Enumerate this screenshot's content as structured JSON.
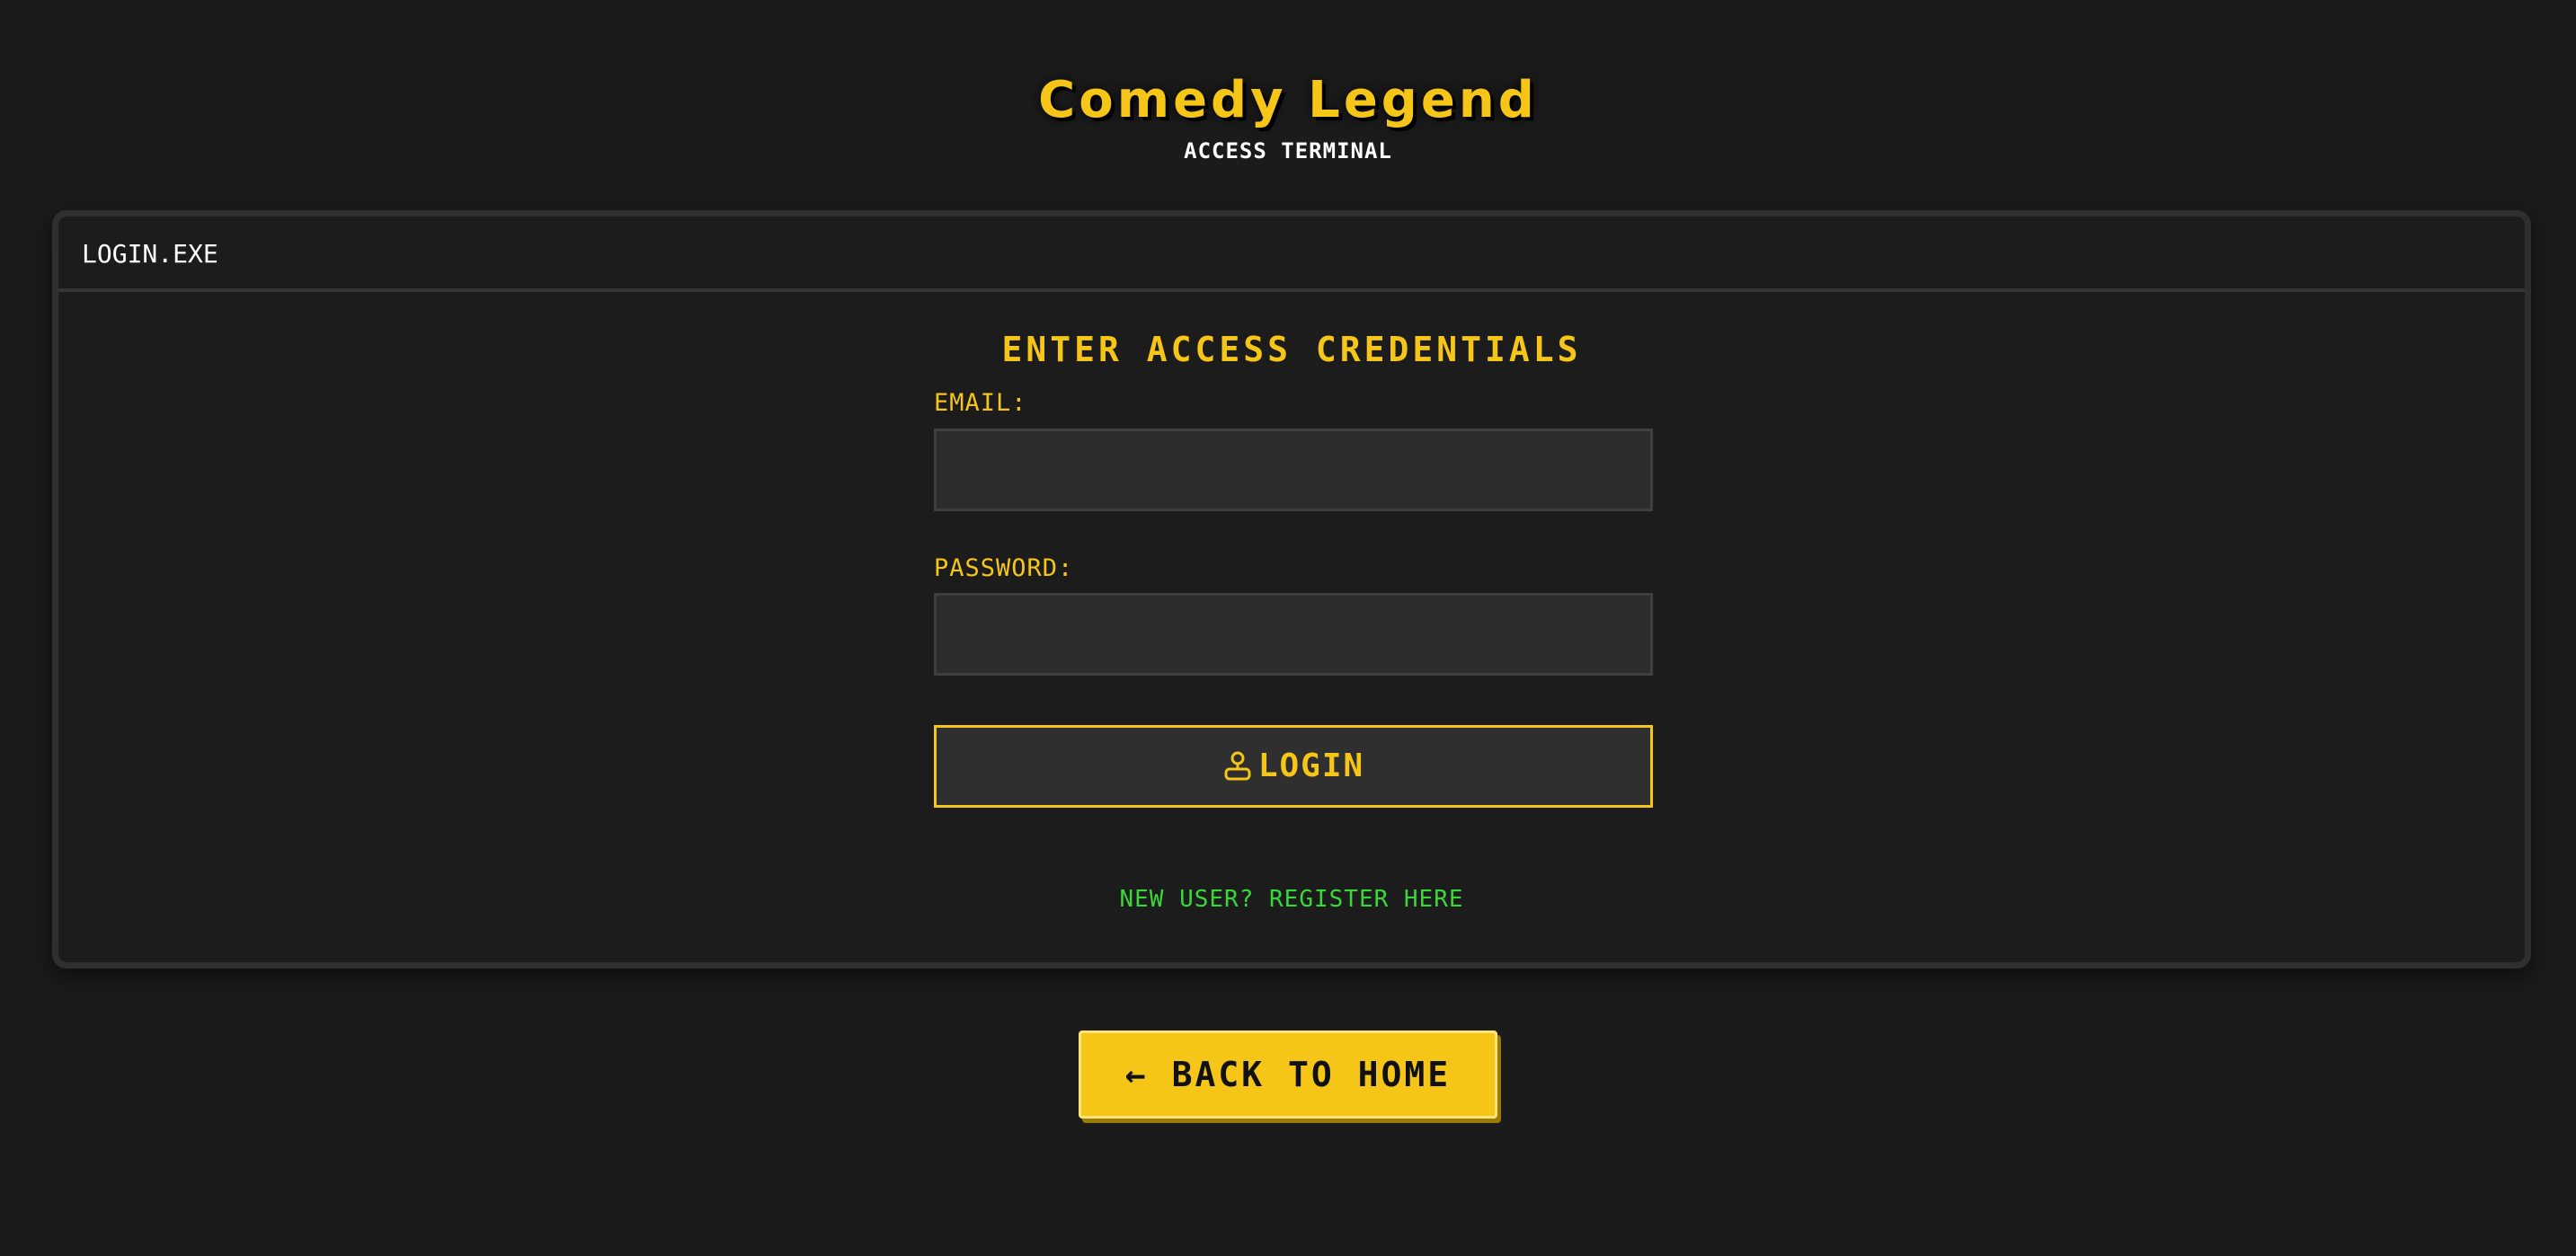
{
  "header": {
    "title": "Comedy Legend",
    "subtitle": "ACCESS TERMINAL"
  },
  "window": {
    "title": "LOGIN.EXE",
    "heading": "ENTER ACCESS CREDENTIALS"
  },
  "form": {
    "email_label": "EMAIL:",
    "email_value": "",
    "password_label": "PASSWORD:",
    "password_value": "",
    "login_label": "LOGIN",
    "login_icon": "user-icon",
    "register_link": "NEW USER? REGISTER HERE"
  },
  "footer": {
    "back_home_label": "← BACK TO HOME"
  },
  "colors": {
    "background": "#1b1b1b",
    "accent": "#f5c518",
    "link": "#39d839",
    "panel_border": "#2f2f2f"
  }
}
